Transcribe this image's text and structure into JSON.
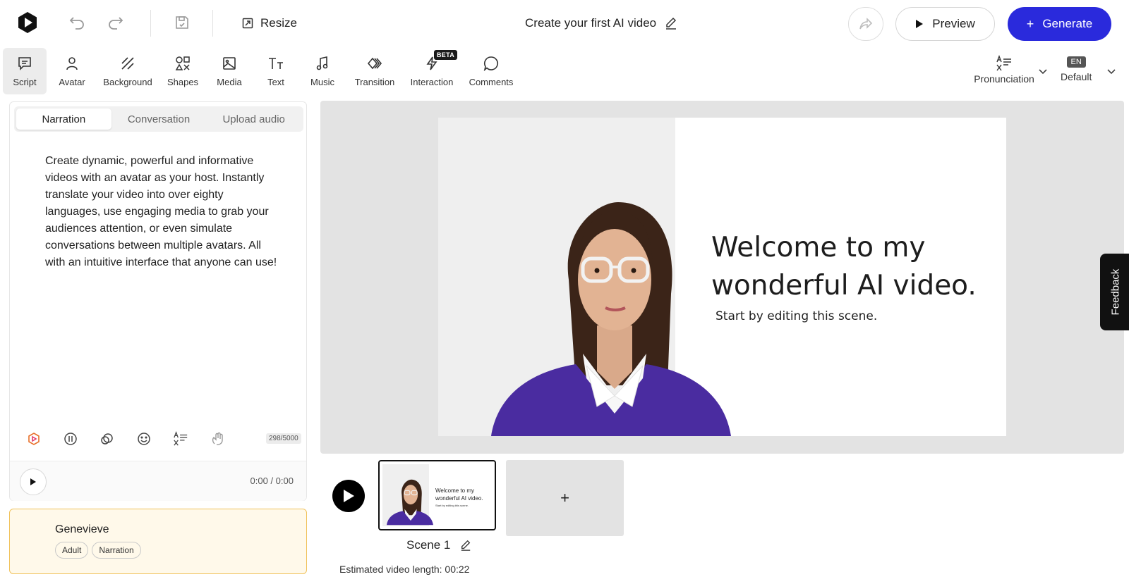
{
  "header": {
    "resize_label": "Resize",
    "project_title": "Create your first AI video",
    "preview_label": "Preview",
    "generate_label": "Generate"
  },
  "toolbar": {
    "items": [
      {
        "label": "Script",
        "icon": "script-icon"
      },
      {
        "label": "Avatar",
        "icon": "avatar-icon"
      },
      {
        "label": "Background",
        "icon": "background-icon"
      },
      {
        "label": "Shapes",
        "icon": "shapes-icon"
      },
      {
        "label": "Media",
        "icon": "media-icon"
      },
      {
        "label": "Text",
        "icon": "text-icon"
      },
      {
        "label": "Music",
        "icon": "music-icon"
      },
      {
        "label": "Transition",
        "icon": "transition-icon"
      },
      {
        "label": "Interaction",
        "icon": "interaction-icon"
      },
      {
        "label": "Comments",
        "icon": "comments-icon"
      }
    ],
    "beta_badge": "BETA",
    "pronunciation_label": "Pronunciation",
    "language_code": "EN",
    "language_label": "Default"
  },
  "script": {
    "tabs": [
      "Narration",
      "Conversation",
      "Upload audio"
    ],
    "text": "Create dynamic, powerful and informative videos with an avatar as your host. Instantly translate your video into over eighty languages, use engaging media to grab your audiences attention, or even simulate conversations between multiple avatars. All with an intuitive interface that anyone can use!",
    "char_count": "298/5000",
    "time": "0:00 / 0:00"
  },
  "avatar": {
    "name": "Genevieve",
    "tags": [
      "Adult",
      "Narration"
    ]
  },
  "slide": {
    "title": "Welcome to my wonderful AI video.",
    "subtitle": "Start by editing this scene."
  },
  "thumbnail": {
    "title": "Welcome to my wonderful AI video.",
    "subtitle": "Start by editing this scene."
  },
  "feedback_label": "Feedback",
  "timeline": {
    "scene_label": "Scene 1",
    "add_label": "+",
    "estimate": "Estimated video length: 00:22"
  },
  "colors": {
    "accent": "#2a2adc",
    "avatar_card_bg": "#fff9ea",
    "avatar_card_border": "#f0c25a",
    "sweater": "#4a2ca0"
  }
}
